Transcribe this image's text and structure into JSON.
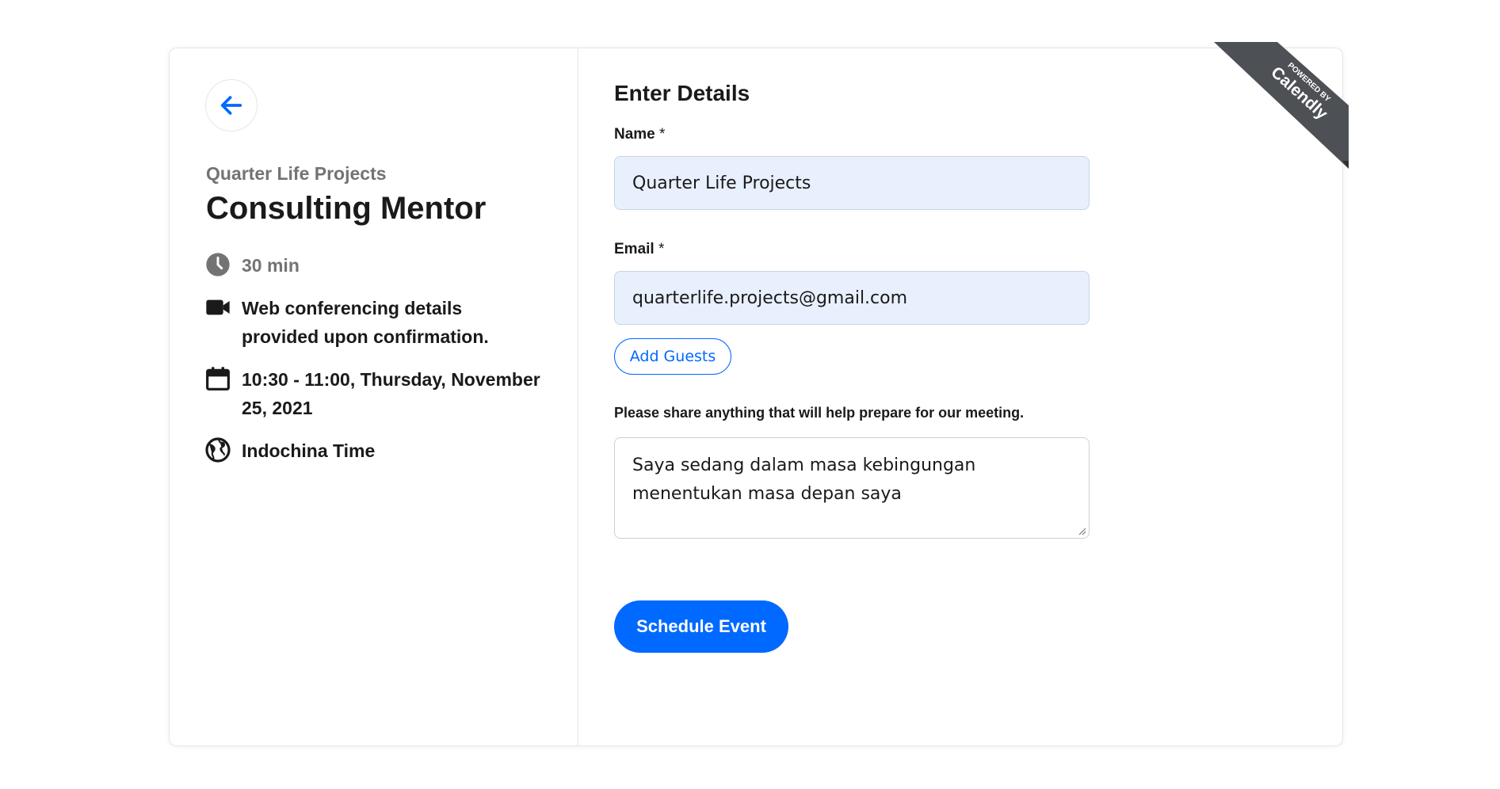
{
  "event": {
    "host": "Quarter Life Projects",
    "title": "Consulting Mentor",
    "duration": "30 min",
    "conferencing_line1": "Web conferencing details",
    "conferencing_line2": "provided upon confirmation.",
    "datetime_line1": "10:30 - 11:00, Thursday, November",
    "datetime_line2": "25, 2021",
    "timezone": "Indochina Time"
  },
  "form": {
    "heading": "Enter Details",
    "name_label": "Name",
    "name_required": " *",
    "name_value": "Quarter Life Projects",
    "email_label": "Email",
    "email_required": " *",
    "email_value": "quarterlife.projects@gmail.com",
    "add_guests_label": "Add Guests",
    "notes_label": "Please share anything that will help prepare for our meeting.",
    "notes_value": "Saya sedang dalam masa kebingungan menentukan masa depan saya",
    "submit_label": "Schedule Event"
  },
  "badge": {
    "powered_by": "POWERED BY",
    "brand": "Calendly"
  },
  "icons": {
    "back": "arrow-left-icon",
    "duration": "clock-icon",
    "conferencing": "video-camera-icon",
    "date": "calendar-icon",
    "timezone": "globe-icon"
  },
  "colors": {
    "accent": "#0069ff",
    "input_fill": "#e8f0fe",
    "muted_text": "#737373",
    "badge_bg": "#4d5055"
  }
}
